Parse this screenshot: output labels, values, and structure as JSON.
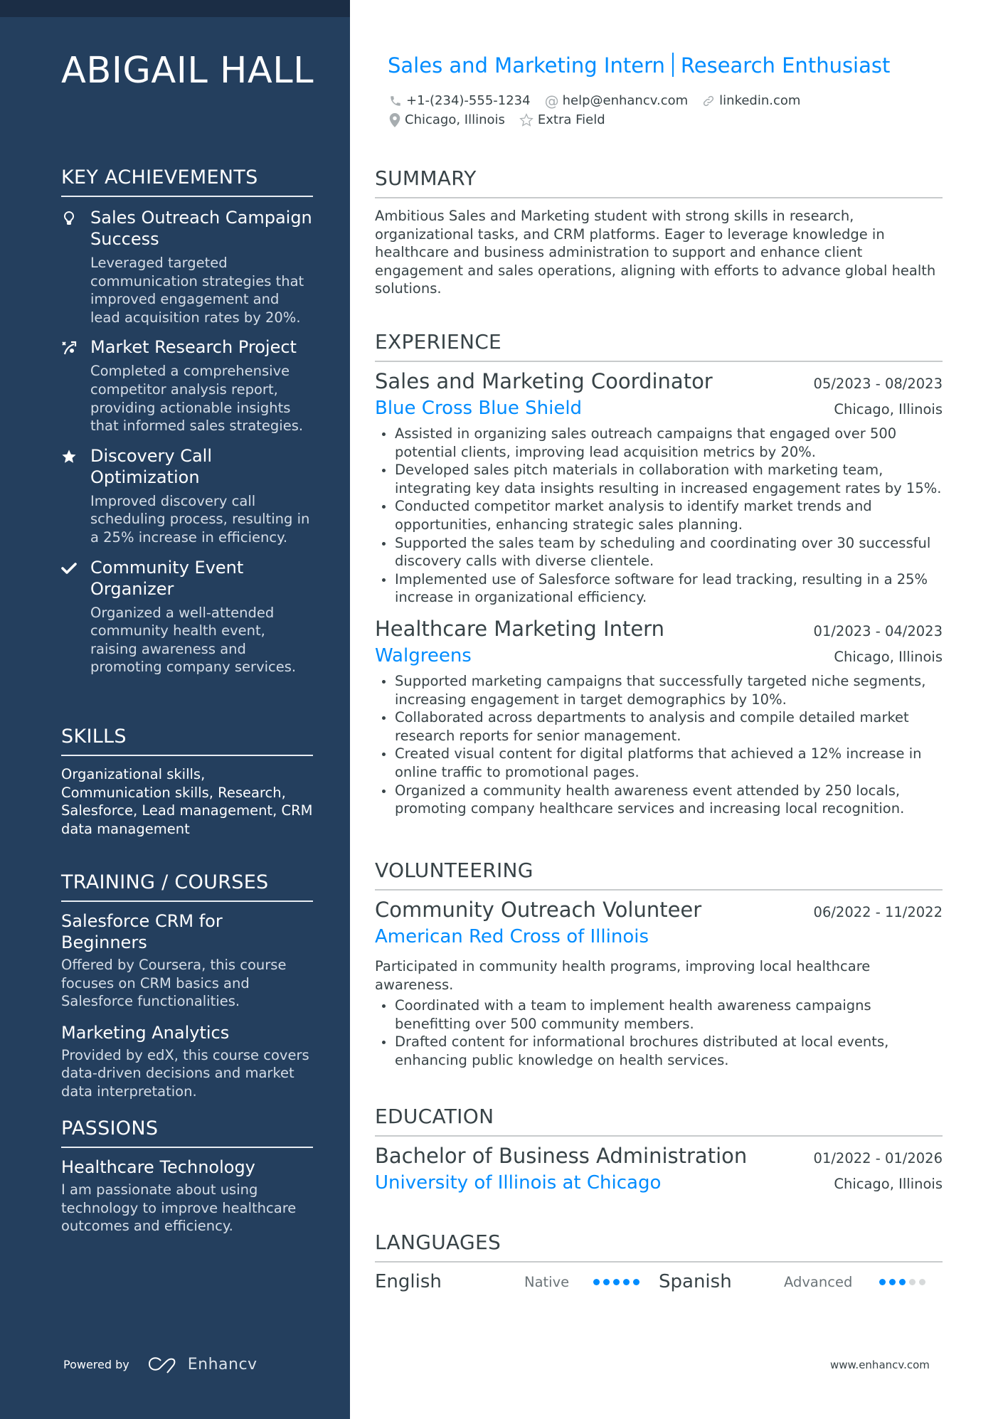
{
  "name": "ABIGAIL HALL",
  "headline": {
    "part1": "Sales and Marketing Intern",
    "part2": "Research Enthusiast"
  },
  "contacts": {
    "phone": "+1-(234)-555-1234",
    "email": "help@enhancv.com",
    "link": "linkedin.com",
    "location": "Chicago, Illinois",
    "extra": "Extra Field"
  },
  "sidebar": {
    "achievements": {
      "heading": "KEY ACHIEVEMENTS",
      "items": [
        {
          "icon": "lightbulb-icon",
          "title": "Sales Outreach Campaign Success",
          "desc": "Leveraged targeted communication strategies that improved engagement and lead acquisition rates by 20%."
        },
        {
          "icon": "strategy-icon",
          "title": "Market Research Project",
          "desc": "Completed a comprehensive competitor analysis report, providing actionable insights that informed sales strategies."
        },
        {
          "icon": "star-icon",
          "title": "Discovery Call Optimization",
          "desc": "Improved discovery call scheduling process, resulting in a 25% increase in efficiency."
        },
        {
          "icon": "checkmark-icon",
          "title": "Community Event Organizer",
          "desc": "Organized a well-attended community health event, raising awareness and promoting company services."
        }
      ]
    },
    "skills": {
      "heading": "SKILLS",
      "text": "Organizational skills, Communication skills, Research, Salesforce, Lead management, CRM data management"
    },
    "training": {
      "heading": "TRAINING / COURSES",
      "items": [
        {
          "title": "Salesforce CRM for Beginners",
          "desc": "Offered by Coursera, this course focuses on CRM basics and Salesforce functionalities."
        },
        {
          "title": "Marketing Analytics",
          "desc": "Provided by edX, this course covers data-driven decisions and market data interpretation."
        }
      ]
    },
    "passions": {
      "heading": "PASSIONS",
      "items": [
        {
          "title": "Healthcare Technology",
          "desc": "I am passionate about using technology to improve healthcare outcomes and efficiency."
        }
      ]
    },
    "powered_by": "Powered by",
    "brand": "Enhancv"
  },
  "summary": {
    "heading": "SUMMARY",
    "text": "Ambitious Sales and Marketing student with strong skills in research, organizational tasks, and CRM platforms. Eager to leverage knowledge in healthcare and business administration to support and enhance client engagement and sales operations, aligning with efforts to advance global health solutions."
  },
  "experience": {
    "heading": "EXPERIENCE",
    "items": [
      {
        "title": "Sales and Marketing Coordinator",
        "dates": "05/2023 - 08/2023",
        "org": "Blue Cross Blue Shield",
        "location": "Chicago, Illinois",
        "bullets": [
          "Assisted in organizing sales outreach campaigns that engaged over 500 potential clients, improving lead acquisition metrics by 20%.",
          "Developed sales pitch materials in collaboration with marketing team, integrating key data insights resulting in increased engagement rates by 15%.",
          "Conducted competitor market analysis to identify market trends and opportunities, enhancing strategic sales planning.",
          "Supported the sales team by scheduling and coordinating over 30 successful discovery calls with diverse clientele.",
          "Implemented use of Salesforce software for lead tracking, resulting in a 25% increase in organizational efficiency."
        ]
      },
      {
        "title": "Healthcare Marketing Intern",
        "dates": "01/2023 - 04/2023",
        "org": "Walgreens",
        "location": "Chicago, Illinois",
        "bullets": [
          "Supported marketing campaigns that successfully targeted niche segments, increasing engagement in target demographics by 10%.",
          "Collaborated across departments to analysis and compile detailed market research reports for senior management.",
          "Created visual content for digital platforms that achieved a 12% increase in online traffic to promotional pages.",
          "Organized a community health awareness event attended by 250 locals, promoting company healthcare services and increasing local recognition."
        ]
      }
    ]
  },
  "volunteering": {
    "heading": "VOLUNTEERING",
    "items": [
      {
        "title": "Community Outreach Volunteer",
        "dates": "06/2022 - 11/2022",
        "org": "American Red Cross of Illinois",
        "desc": "Participated in community health programs, improving local healthcare awareness.",
        "bullets": [
          "Coordinated with a team to implement health awareness campaigns benefitting over 500 community members.",
          "Drafted content for informational brochures distributed at local events, enhancing public knowledge on health services."
        ]
      }
    ]
  },
  "education": {
    "heading": "EDUCATION",
    "items": [
      {
        "degree": "Bachelor of Business Administration",
        "dates": "01/2022 - 01/2026",
        "school": "University of Illinois at Chicago",
        "location": "Chicago, Illinois"
      }
    ]
  },
  "languages": {
    "heading": "LANGUAGES",
    "items": [
      {
        "name": "English",
        "level": "Native",
        "rating": 5,
        "max": 5
      },
      {
        "name": "Spanish",
        "level": "Advanced",
        "rating": 3,
        "max": 5
      }
    ]
  },
  "footer_url": "www.enhancv.com",
  "colors": {
    "sidebar": "#243f5e",
    "sidebar_strip": "#1b2d45",
    "accent": "#008cff",
    "text": "#384347"
  }
}
